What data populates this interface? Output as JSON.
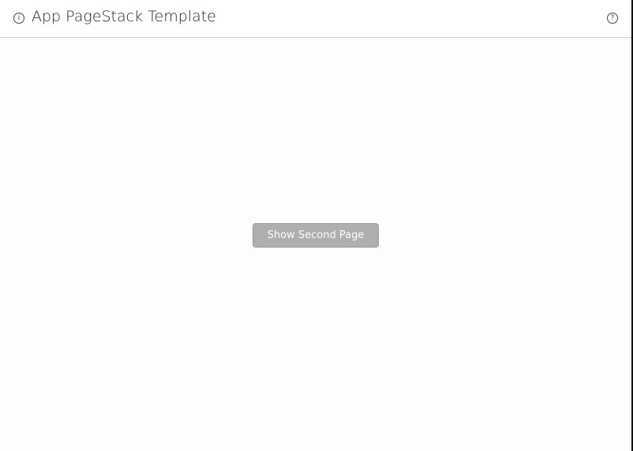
{
  "header": {
    "title": "App PageStack Template",
    "info_icon": "i",
    "help_icon": "?"
  },
  "main": {
    "show_second_page_label": "Show Second Page"
  },
  "colors": {
    "button_bg": "#aeaeae",
    "divider": "#cdcdcd"
  }
}
